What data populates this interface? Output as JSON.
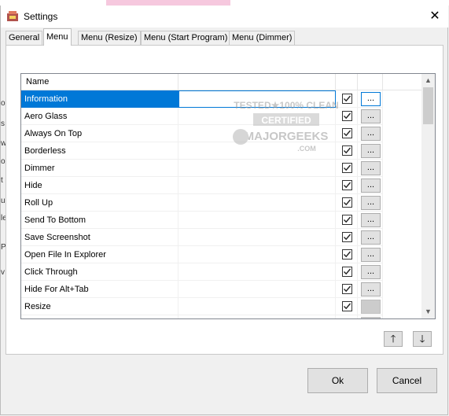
{
  "window": {
    "title": "Settings",
    "close_glyph": "✕"
  },
  "tabs": [
    {
      "label": "General",
      "active": false
    },
    {
      "label": "Menu",
      "active": true
    },
    {
      "label": "Menu (Resize)",
      "active": false
    },
    {
      "label": "Menu (Start Program)",
      "active": false
    },
    {
      "label": "Menu (Dimmer)",
      "active": false
    }
  ],
  "list": {
    "header": {
      "name": "Name"
    },
    "button_label": "...",
    "rows": [
      {
        "name": "Information",
        "checked": true,
        "selected": true
      },
      {
        "name": "Aero Glass",
        "checked": true
      },
      {
        "name": "Always On Top",
        "checked": true
      },
      {
        "name": "Borderless",
        "checked": true
      },
      {
        "name": "Dimmer",
        "checked": true
      },
      {
        "name": "Hide",
        "checked": true
      },
      {
        "name": "Roll Up",
        "checked": true
      },
      {
        "name": "Send To Bottom",
        "checked": true
      },
      {
        "name": "Save Screenshot",
        "checked": true
      },
      {
        "name": "Open File In Explorer",
        "checked": true
      },
      {
        "name": "Click Through",
        "checked": true
      },
      {
        "name": "Hide For Alt+Tab",
        "checked": true
      },
      {
        "name": "Resize",
        "checked": true,
        "button_disabled": true
      },
      {
        "name": "",
        "checked": true,
        "button_disabled": true
      }
    ],
    "scroll": {
      "up_glyph": "▲",
      "down_glyph": "▼"
    }
  },
  "move_buttons": {
    "up": "🡑",
    "down": "🡓"
  },
  "dialog_buttons": {
    "ok": "Ok",
    "cancel": "Cancel"
  },
  "watermark": {
    "line1": "TESTED★100% CLEAN",
    "line2": "CERTIFIED",
    "line3": "MAJORGEEKS",
    "line4": ".COM"
  },
  "background_fragments": [
    "o",
    "s",
    "w",
    "o",
    "t",
    "u",
    "le",
    "P",
    "v"
  ],
  "colors": {
    "selection": "#0078d7",
    "window_bg": "#f0f0f0"
  }
}
